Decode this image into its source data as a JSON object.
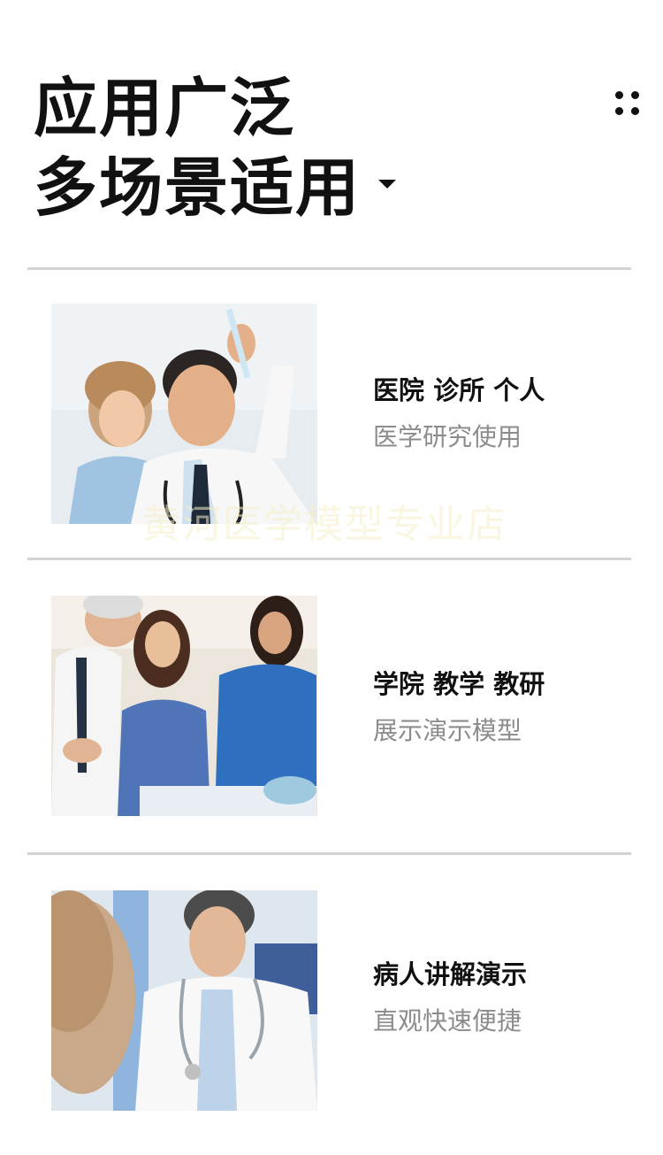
{
  "header": {
    "title_line1": "应用广泛",
    "title_line2": "多场景适用",
    "caret_icon": "caret-down-icon",
    "menu_icon": "more-dots-icon"
  },
  "items": [
    {
      "title": "医院 诊所 个人",
      "subtitle": "医学研究使用",
      "image": "doctors-lab-photo"
    },
    {
      "title": "学院 教学 教研",
      "subtitle": "展示演示模型",
      "image": "teaching-class-photo"
    },
    {
      "title": "病人讲解演示",
      "subtitle": "直观快速便捷",
      "image": "doctor-patient-photo"
    }
  ],
  "watermark": "黄河医学模型专业店"
}
